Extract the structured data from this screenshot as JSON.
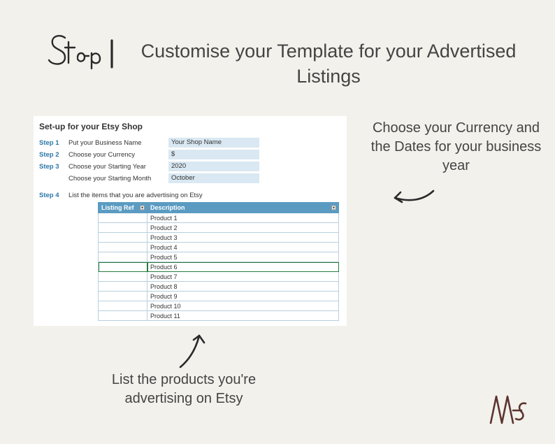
{
  "step_label": {
    "word": "Step",
    "num": "1"
  },
  "heading": "Customise your Template for your Advertised Listings",
  "spreadsheet": {
    "title": "Set-up for your Etsy Shop",
    "rows": [
      {
        "step": "Step 1",
        "label": "Put your Business Name",
        "value": "Your Shop Name"
      },
      {
        "step": "Step 2",
        "label": "Choose your Currency",
        "value": "$"
      },
      {
        "step": "Step 3",
        "label": "Choose your Starting Year",
        "value": "2020"
      },
      {
        "step": "",
        "label": "Choose your Starting Month",
        "value": "October"
      }
    ],
    "step4": {
      "step": "Step 4",
      "label": "List the items that you are advertising on Etsy"
    },
    "table": {
      "headers": {
        "ref": "Listing Ref",
        "desc": "Description"
      },
      "products": [
        "Product 1",
        "Product 2",
        "Product 3",
        "Product 4",
        "Product 5",
        "Product 6",
        "Product 7",
        "Product 8",
        "Product 9",
        "Product 10",
        "Product 11"
      ],
      "highlight_index": 5
    }
  },
  "callout_right": "Choose your Currency and the Dates for your business year",
  "callout_bottom": "List the products you're advertising on Etsy",
  "colors": {
    "header_blue": "#5b9bc2",
    "cell_blue": "#d9e8f2",
    "step_text": "#2b78a8",
    "border_blue": "#b8cfdc",
    "logo": "#5d332f"
  }
}
